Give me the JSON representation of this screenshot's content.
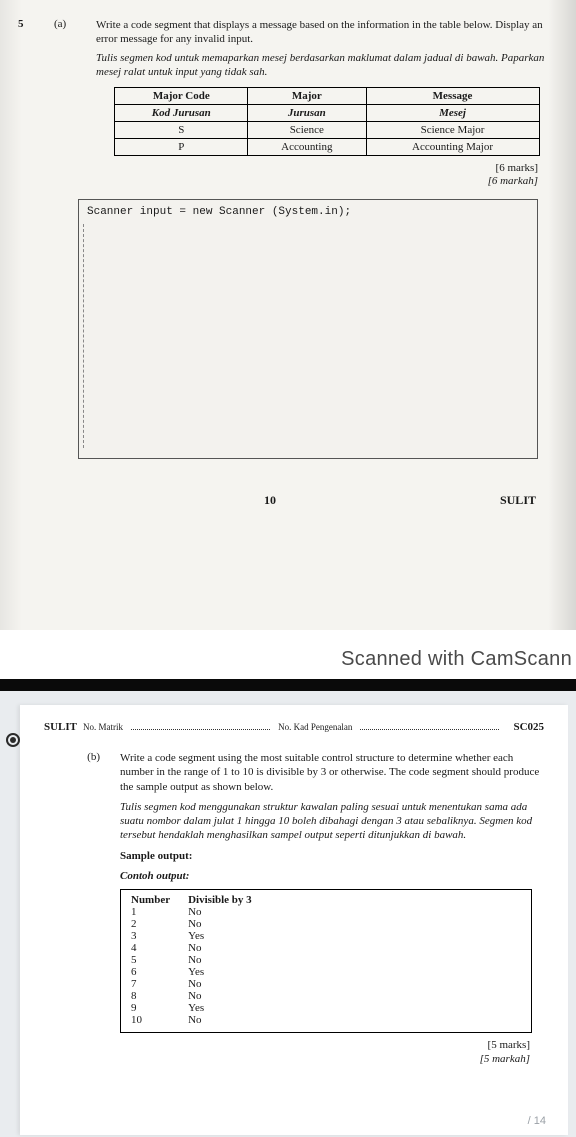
{
  "page1": {
    "q_num": "5",
    "q_sub": "(a)",
    "prompt_en": "Write a code segment that displays a message based on the information in the table below. Display an error message for any invalid input.",
    "prompt_ms": "Tulis segmen kod untuk memaparkan mesej berdasarkan maklumat dalam jadual di bawah. Paparkan mesej ralat untuk input yang tidak sah.",
    "table": {
      "head_en": [
        "Major Code",
        "Major",
        "Message"
      ],
      "head_ms": [
        "Kod Jurusan",
        "Jurusan",
        "Mesej"
      ],
      "rows": [
        {
          "code": "S",
          "major": "Science",
          "message": "Science Major"
        },
        {
          "code": "P",
          "major": "Accounting",
          "message": "Accounting Major"
        }
      ]
    },
    "marks_en": "[6 marks]",
    "marks_ms": "[6 markah]",
    "code_line": "Scanner input = new Scanner (System.in);",
    "page_number": "10",
    "footer_right": "SULIT"
  },
  "scan_label": "Scanned with CamScann",
  "page2": {
    "header": {
      "sulit": "SULIT",
      "matrik_label": "No. Matrik",
      "kad_label": "No. Kad Pengenalan",
      "course_code": "SC025"
    },
    "q_sub": "(b)",
    "prompt_en": "Write a code segment using the most suitable control structure to determine whether each number in the range of 1 to 10 is divisible by 3 or otherwise. The code segment should produce the sample output as shown below.",
    "prompt_ms": "Tulis segmen kod menggunakan struktur kawalan paling sesuai untuk menentukan sama ada suatu nombor dalam julat 1 hingga 10 boleh dibahagi dengan 3 atau sebaliknya. Segmen kod tersebut hendaklah menghasilkan sampel output seperti ditunjukkan di bawah.",
    "sample_label_en": "Sample output:",
    "sample_label_ms": "Contoh output:",
    "output_headers": [
      "Number",
      "Divisible by 3"
    ],
    "output_rows": [
      {
        "n": "1",
        "d": "No"
      },
      {
        "n": "2",
        "d": "No"
      },
      {
        "n": "3",
        "d": "Yes"
      },
      {
        "n": "4",
        "d": "No"
      },
      {
        "n": "5",
        "d": "No"
      },
      {
        "n": "6",
        "d": "Yes"
      },
      {
        "n": "7",
        "d": "No"
      },
      {
        "n": "8",
        "d": "No"
      },
      {
        "n": "9",
        "d": "Yes"
      },
      {
        "n": "10",
        "d": "No"
      }
    ],
    "marks_en": "[5 marks]",
    "marks_ms": "[5 markah]",
    "page_badge": "/ 14"
  }
}
